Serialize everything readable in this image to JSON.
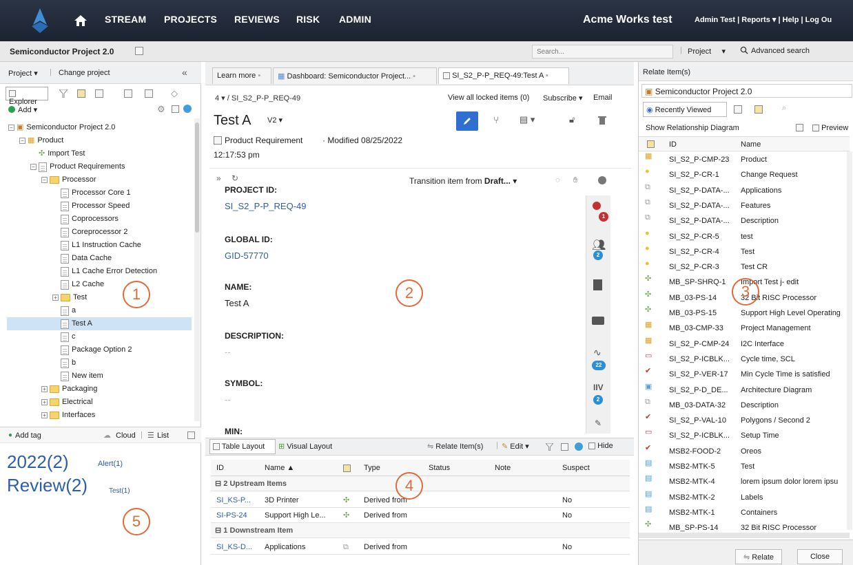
{
  "topnav": {
    "stream": "STREAM",
    "projects": "PROJECTS",
    "reviews": "REVIEWS",
    "risk": "RISK",
    "admin": "ADMIN",
    "brand": "Acme Works test",
    "user": "Admin Test",
    "reports": "Reports ▾",
    "help": "Help",
    "logout": "Log Ou"
  },
  "projbar": {
    "title": "Semiconductor Project 2.0",
    "search_placeholder": "Search...",
    "scope": "Project",
    "advanced": "Advanced search"
  },
  "left": {
    "project_menu": "Project ▾",
    "change_project": "Change project",
    "explorer_tab": "Explorer",
    "add": "Add ▾",
    "tree": [
      {
        "label": "Semiconductor Project 2.0",
        "level": 0,
        "kind": "project",
        "exp": "−"
      },
      {
        "label": "Product",
        "level": 1,
        "kind": "component",
        "exp": "−"
      },
      {
        "label": "Import Test",
        "level": 2,
        "kind": "puzzle",
        "exp": ""
      },
      {
        "label": "Product Requirements",
        "level": 2,
        "kind": "set",
        "exp": "−"
      },
      {
        "label": "Processor",
        "level": 3,
        "kind": "folder",
        "exp": "−"
      },
      {
        "label": "Processor Core 1",
        "level": 4,
        "kind": "doc",
        "exp": ""
      },
      {
        "label": "Processor Speed",
        "level": 4,
        "kind": "doc",
        "exp": ""
      },
      {
        "label": "Coprocessors",
        "level": 4,
        "kind": "doc",
        "exp": ""
      },
      {
        "label": "Coreprocessor 2",
        "level": 4,
        "kind": "doc",
        "exp": ""
      },
      {
        "label": "L1 Instruction Cache",
        "level": 4,
        "kind": "doc",
        "exp": ""
      },
      {
        "label": "Data Cache",
        "level": 4,
        "kind": "doc",
        "exp": ""
      },
      {
        "label": "L1 Cache Error Detection",
        "level": 4,
        "kind": "doc",
        "exp": ""
      },
      {
        "label": "L2 Cache",
        "level": 4,
        "kind": "doc",
        "exp": ""
      },
      {
        "label": "Test",
        "level": 4,
        "kind": "folder",
        "exp": "+"
      },
      {
        "label": "a",
        "level": 4,
        "kind": "doc",
        "exp": ""
      },
      {
        "label": "Test A",
        "level": 4,
        "kind": "doc",
        "exp": "",
        "selected": true
      },
      {
        "label": "c",
        "level": 4,
        "kind": "doc",
        "exp": ""
      },
      {
        "label": "Package Option 2",
        "level": 4,
        "kind": "doc",
        "exp": ""
      },
      {
        "label": "b",
        "level": 4,
        "kind": "doc",
        "exp": ""
      },
      {
        "label": "New item",
        "level": 4,
        "kind": "doc",
        "exp": ""
      },
      {
        "label": "Packaging",
        "level": 3,
        "kind": "folder",
        "exp": "+"
      },
      {
        "label": "Electrical",
        "level": 3,
        "kind": "folder",
        "exp": "+"
      },
      {
        "label": "Interfaces",
        "level": 3,
        "kind": "folder",
        "exp": "+"
      }
    ],
    "add_tag": "Add tag",
    "cloud": "Cloud",
    "list": "List",
    "tags": {
      "big1": "2022(2)",
      "small1": "Alert(1)",
      "big2": "Review(2)",
      "small2": "Test(1)"
    }
  },
  "center": {
    "tabs": [
      "Learn more",
      "Dashboard: Semiconductor Project...",
      "SI_S2_P-P_REQ-49:Test A"
    ],
    "breadcrumb": "4 ▾  /  SI_S2_P-P_REQ-49",
    "locked": "View all locked items (0)",
    "subscribe": "Subscribe ▾",
    "email": "Email",
    "title": "Test A",
    "version": "V2 ▾",
    "item_type": "Product Requirement",
    "modified": "· Modified 08/25/2022",
    "time": "12:17:53 pm",
    "transition": "Transition item from ",
    "transition_bold": "Draft...",
    "fields": [
      {
        "label": "PROJECT ID:",
        "value": "SI_S2_P-P_REQ-49",
        "link": true
      },
      {
        "label": "GLOBAL ID:",
        "value": "GID-57770",
        "link": true
      },
      {
        "label": "NAME:",
        "value": "Test A",
        "link": false
      },
      {
        "label": "DESCRIPTION:",
        "value": "--",
        "link": false
      },
      {
        "label": "SYMBOL:",
        "value": "--",
        "link": false
      },
      {
        "label": "MIN:",
        "value": "",
        "link": false
      }
    ],
    "badges": {
      "relations": "1",
      "users": "2",
      "activity": "22",
      "tests": "2"
    },
    "layout_tab": "Table Layout",
    "visual_tab": "Visual Layout",
    "relate": "Relate Item(s)",
    "edit": "Edit ▾",
    "hide": "Hide",
    "columns": [
      "ID",
      "Name ▲",
      "",
      "Type",
      "Status",
      "Note",
      "Suspect"
    ],
    "groups": [
      {
        "label": "2 Upstream Items",
        "rows": [
          {
            "id": "SI_KS-P...",
            "name": "3D Printer",
            "type": "Derived from",
            "status": "",
            "note": "",
            "suspect": "No"
          },
          {
            "id": "SI-PS-24",
            "name": "Support High Le...",
            "type": "Derived from",
            "status": "",
            "note": "",
            "suspect": "No"
          }
        ]
      },
      {
        "label": "1 Downstream Item",
        "rows": [
          {
            "id": "SI_KS-D...",
            "name": "Applications",
            "type": "Derived from",
            "status": "",
            "note": "",
            "suspect": "No"
          }
        ]
      }
    ]
  },
  "right": {
    "header": "Relate Item(s)",
    "project": "Semiconductor Project 2.0",
    "recent_tab": "Recently Viewed",
    "show_diagram": "Show Relationship Diagram",
    "preview": "Preview",
    "col_id": "ID",
    "col_name": "Name",
    "rows": [
      {
        "icon": "component",
        "id": "SI_S2_P-CMP-23",
        "name": "Product"
      },
      {
        "icon": "bulb",
        "id": "SI_S2_P-CR-1",
        "name": "Change Request"
      },
      {
        "icon": "copy",
        "id": "SI_S2_P-DATA-...",
        "name": "Applications"
      },
      {
        "icon": "copy",
        "id": "SI_S2_P-DATA-...",
        "name": "Features"
      },
      {
        "icon": "copy",
        "id": "SI_S2_P-DATA-...",
        "name": "Description"
      },
      {
        "icon": "bulb",
        "id": "SI_S2_P-CR-5",
        "name": "test"
      },
      {
        "icon": "bulb",
        "id": "SI_S2_P-CR-4",
        "name": "Test"
      },
      {
        "icon": "bulb",
        "id": "SI_S2_P-CR-3",
        "name": "Test CR"
      },
      {
        "icon": "puzzle",
        "id": "MB_SP-SHRQ-1",
        "name": "Import Test j- edit"
      },
      {
        "icon": "puzzle",
        "id": "MB_03-PS-14",
        "name": "32 Bit RISC Processor"
      },
      {
        "icon": "puzzle",
        "id": "MB_03-PS-15",
        "name": "Support High Level Operating"
      },
      {
        "icon": "component",
        "id": "MB_03-CMP-33",
        "name": "Project Management"
      },
      {
        "icon": "component",
        "id": "SI_S2_P-CMP-24",
        "name": "I2C Interface"
      },
      {
        "icon": "page",
        "id": "SI_S2_P-ICBLK...",
        "name": "Cycle time, SCL"
      },
      {
        "icon": "check",
        "id": "SI_S2_P-VER-17",
        "name": "Min Cycle Time is satisfied"
      },
      {
        "icon": "image",
        "id": "SI_S2_P-D_DE...",
        "name": "Architecture Diagram"
      },
      {
        "icon": "copy",
        "id": "MB_03-DATA-32",
        "name": "Description"
      },
      {
        "icon": "check",
        "id": "SI_S2_P-VAL-10",
        "name": "Polygons / Second 2"
      },
      {
        "icon": "page",
        "id": "SI_S2_P-ICBLK...",
        "name": "Setup Time"
      },
      {
        "icon": "check",
        "id": "MSB2-FOOD-2",
        "name": "Oreos"
      },
      {
        "icon": "window",
        "id": "MSB2-MTK-5",
        "name": "Test"
      },
      {
        "icon": "window",
        "id": "MSB2-MTK-4",
        "name": "lorem ipsum dolor lorem ipsu"
      },
      {
        "icon": "window",
        "id": "MSB2-MTK-2",
        "name": "Labels"
      },
      {
        "icon": "window",
        "id": "MSB2-MTK-1",
        "name": "Containers"
      },
      {
        "icon": "puzzle",
        "id": "MB_SP-PS-14",
        "name": "32 Bit RISC Processor"
      }
    ],
    "relate_btn": "Relate",
    "close_btn": "Close"
  },
  "callouts": [
    "1",
    "2",
    "3",
    "4",
    "5"
  ]
}
